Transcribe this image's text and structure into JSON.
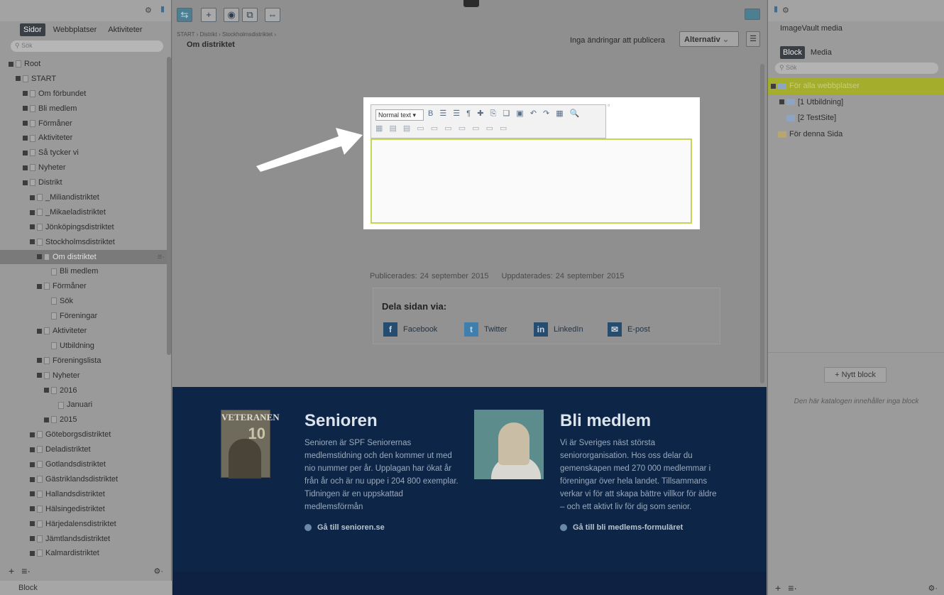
{
  "left_pane": {
    "tabs": [
      "Sidor",
      "Webbplatser",
      "Aktiviteter"
    ],
    "active_tab": "Sidor",
    "search_placeholder": "Sök",
    "tree": [
      {
        "label": "Root",
        "indent": 0,
        "expander": true,
        "icon": "root"
      },
      {
        "label": "START",
        "indent": 1,
        "expander": true,
        "icon": "home"
      },
      {
        "label": "Om förbundet",
        "indent": 2,
        "expander": true
      },
      {
        "label": "Bli medlem",
        "indent": 2,
        "expander": true
      },
      {
        "label": "Förmåner",
        "indent": 2,
        "expander": true
      },
      {
        "label": "Aktiviteter",
        "indent": 2,
        "expander": true
      },
      {
        "label": "Så tycker vi",
        "indent": 2,
        "expander": true
      },
      {
        "label": "Nyheter",
        "indent": 2,
        "expander": true
      },
      {
        "label": "Distrikt",
        "indent": 2,
        "expander": true
      },
      {
        "label": "_Miliandistriktet",
        "indent": 3,
        "expander": true
      },
      {
        "label": "_Mikaeladistriktet",
        "indent": 3,
        "expander": true
      },
      {
        "label": "Jönköpingsdistriktet",
        "indent": 3,
        "expander": true
      },
      {
        "label": "Stockholmsdistriktet",
        "indent": 3,
        "expander": true
      },
      {
        "label": "Om distriktet",
        "indent": 4,
        "expander": true,
        "selected": true
      },
      {
        "label": "Bli medlem",
        "indent": 5,
        "expander": false
      },
      {
        "label": "Förmåner",
        "indent": 4,
        "expander": true
      },
      {
        "label": "Sök",
        "indent": 5,
        "expander": false
      },
      {
        "label": "Föreningar",
        "indent": 5,
        "expander": false
      },
      {
        "label": "Aktiviteter",
        "indent": 4,
        "expander": true
      },
      {
        "label": "Utbildning",
        "indent": 5,
        "expander": false
      },
      {
        "label": "Föreningslista",
        "indent": 4,
        "expander": true
      },
      {
        "label": "Nyheter",
        "indent": 4,
        "expander": true
      },
      {
        "label": "2016",
        "indent": 5,
        "expander": true
      },
      {
        "label": "Januari",
        "indent": 6,
        "expander": false
      },
      {
        "label": "2015",
        "indent": 5,
        "expander": true
      },
      {
        "label": "Göteborgsdistriktet",
        "indent": 3,
        "expander": true
      },
      {
        "label": "Deladistriktet",
        "indent": 3,
        "expander": true
      },
      {
        "label": "Gotlandsdistriktet",
        "indent": 3,
        "expander": true
      },
      {
        "label": "Gästriklandsdistriktet",
        "indent": 3,
        "expander": true
      },
      {
        "label": "Hallandsdistriktet",
        "indent": 3,
        "expander": true
      },
      {
        "label": "Hälsingedistriktet",
        "indent": 3,
        "expander": true
      },
      {
        "label": "Härjedalensdistriktet",
        "indent": 3,
        "expander": true
      },
      {
        "label": "Jämtlandsdistriktet",
        "indent": 3,
        "expander": true
      },
      {
        "label": "Kalmardistriktet",
        "indent": 3,
        "expander": true
      }
    ],
    "bottom_add": "+",
    "bottom_menu": "≡·",
    "bottom_gear": "⚙·",
    "block_label": "Block"
  },
  "toolbar": {
    "breadcrumb": "START › Distrikt › Stockholmsdistriktet ›",
    "page_title": "Om distriktet",
    "status": "Inga ändringar att publicera",
    "options_label": "Alternativ",
    "icons": [
      "structure-icon",
      "add-icon",
      "preview-icon",
      "compare-icon",
      "expand-icon"
    ]
  },
  "editor": {
    "format_select": "Normal text",
    "row1_icons": "B ☰ ☰ ¶ ✚ ⎘ ❑ ▣ ↶ ↷ ▦ 🔍",
    "row2_icons": "▦ ▤ ▤ ▭ ▭ ▭ ▭ ▭ ▭ ▭"
  },
  "content": {
    "published": "Publicerades: 24 september 2015",
    "updated": "Uppdaterades: 24 september 2015",
    "share_title": "Dela sidan via:",
    "share": [
      {
        "label": "Facebook",
        "icon": "f"
      },
      {
        "label": "Twitter",
        "icon": "t"
      },
      {
        "label": "LinkedIn",
        "icon": "in"
      },
      {
        "label": "E-post",
        "icon": "✉"
      }
    ]
  },
  "promo": {
    "magazine_title": "VETERANEN",
    "magazine_number": "10",
    "col1": {
      "heading": "Senioren",
      "body": "Senioren är SPF Seniorernas medlemstidning och den kommer ut med nio nummer per år. Upplagan har ökat år från år och är nu uppe i 204 800 exemplar. Tidningen är en uppskattad medlemsförmån",
      "link": "Gå till senioren.se"
    },
    "col2": {
      "heading": "Bli medlem",
      "body": "Vi är Sveriges näst största seniororganisation. Hos oss delar du gemenskapen med 270 000 medlemmar i föreningar över hela landet. Tillsammans verkar vi för att skapa bättre villkor för äldre – och ett aktivt liv för dig som senior.",
      "link": "Gå till bli medlems-formuläret"
    }
  },
  "right_pane": {
    "title": "ImageVault media",
    "tabs": [
      "Block",
      "Media"
    ],
    "active_tab": "Block",
    "search_placeholder": "Sök",
    "tree": [
      {
        "label": "För alla webbplatser",
        "indent": 0,
        "selected": true,
        "expander": true
      },
      {
        "label": "[1 Utbildning]",
        "indent": 1,
        "expander": true
      },
      {
        "label": "[2 TestSite]",
        "indent": 1,
        "expander": false
      },
      {
        "label": "För denna Sida",
        "indent": 0,
        "expander": false,
        "yellow": true
      }
    ],
    "new_block": "+ Nytt block",
    "empty_text": "Den här katalogen innehåller inga block",
    "bottom_add": "+",
    "bottom_menu": "≡·",
    "bottom_gear": "⚙·"
  },
  "colors": {
    "promo_bg": "#0d2546",
    "accent_green": "#c6d654",
    "selected_folder": "#a4ad2c"
  }
}
